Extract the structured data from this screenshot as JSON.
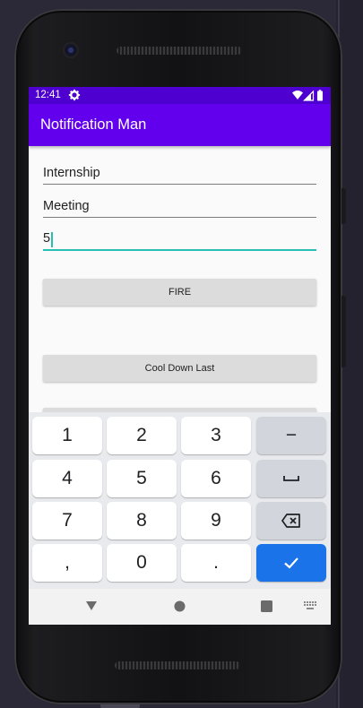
{
  "status_bar": {
    "time": "12:41"
  },
  "app_bar": {
    "title": "Notification Man"
  },
  "form": {
    "title_value": "Internship",
    "message_value": "Meeting",
    "delay_value": "5"
  },
  "buttons": {
    "fire_label": "FIRE",
    "cool_down_label": "Cool Down Last"
  },
  "keyboard": {
    "rows": [
      [
        "1",
        "2",
        "3",
        "−"
      ],
      [
        "4",
        "5",
        "6",
        "␣"
      ],
      [
        "7",
        "8",
        "9",
        "⌫"
      ],
      [
        ",",
        "0",
        ".",
        "✓"
      ]
    ]
  },
  "colors": {
    "status_bar": "#4e00d1",
    "app_bar": "#6200ee",
    "accent": "#26bfb3",
    "enter_key": "#1a73e8"
  }
}
